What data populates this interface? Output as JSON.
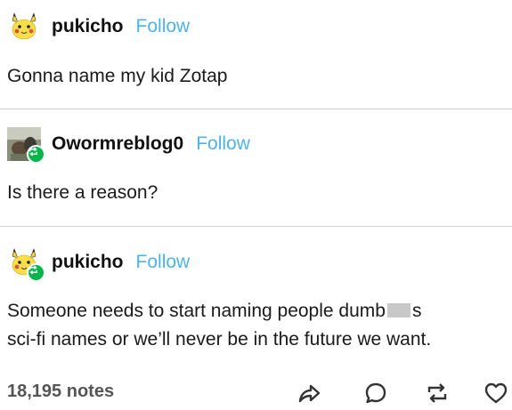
{
  "posts": [
    {
      "username": "pukicho",
      "follow_label": "Follow",
      "avatar_icon": "pikachu-avatar-icon",
      "is_reblog": false,
      "text": "Gonna name my kid Zotap"
    },
    {
      "username": "Owormreblog0",
      "follow_label": "Follow",
      "avatar_icon": "photo-avatar-icon",
      "is_reblog": true,
      "text": "Is there a reason?"
    },
    {
      "username": "pukicho",
      "follow_label": "Follow",
      "avatar_icon": "pikachu-avatar-icon",
      "is_reblog": true,
      "text_line1_a": "Someone needs to start naming people dumb",
      "text_line1_b": "s",
      "text_line2": "sci-fi names or we’ll never be in the future we want."
    }
  ],
  "footer": {
    "notes": "18,195 notes",
    "actions": [
      "share-icon",
      "reply-icon",
      "reblog-icon",
      "like-icon"
    ]
  },
  "colors": {
    "follow": "#4eb3e6",
    "reblog_badge": "#00b54a",
    "divider": "#cfcfcf"
  }
}
